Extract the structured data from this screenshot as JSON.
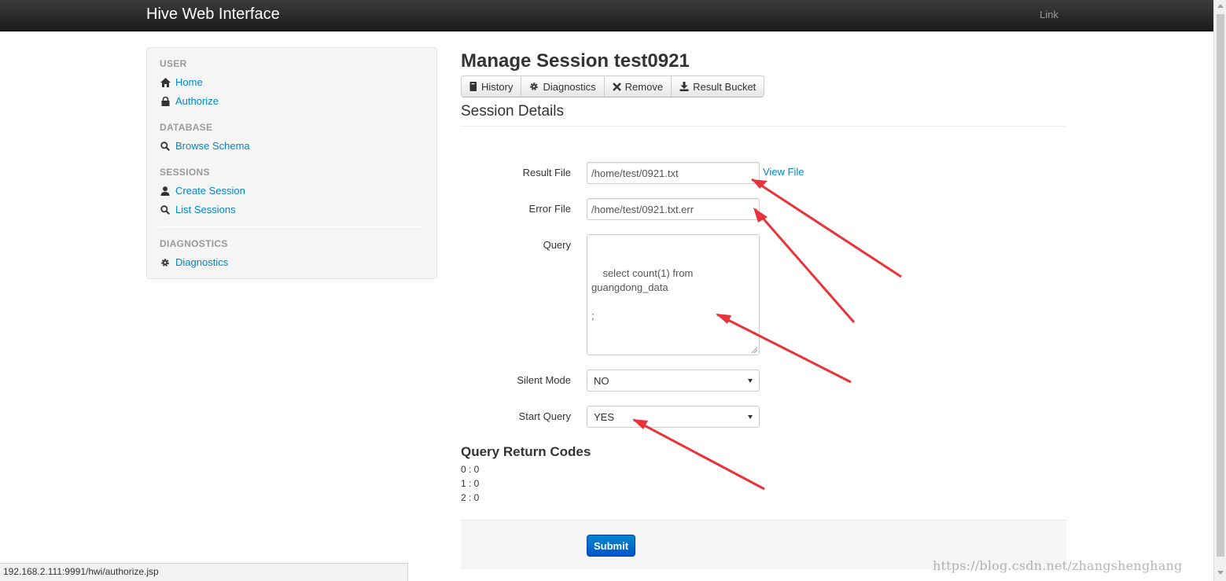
{
  "navbar": {
    "brand": "Hive Web Interface",
    "link": "Link"
  },
  "sidebar": {
    "sections": [
      {
        "header": "USER",
        "items": [
          {
            "label": "Home",
            "icon": "home-icon"
          },
          {
            "label": "Authorize",
            "icon": "lock-icon"
          }
        ]
      },
      {
        "header": "DATABASE",
        "items": [
          {
            "label": "Browse Schema",
            "icon": "search-icon"
          }
        ]
      },
      {
        "header": "SESSIONS",
        "items": [
          {
            "label": "Create Session",
            "icon": "user-icon"
          },
          {
            "label": "List Sessions",
            "icon": "search-icon"
          }
        ]
      },
      {
        "header": "DIAGNOSTICS",
        "items": [
          {
            "label": "Diagnostics",
            "icon": "gear-icon"
          }
        ]
      }
    ]
  },
  "main": {
    "title": "Manage Session test0921",
    "buttons": [
      {
        "label": "History",
        "icon": "book-icon"
      },
      {
        "label": "Diagnostics",
        "icon": "gear-icon"
      },
      {
        "label": "Remove",
        "icon": "remove-icon"
      },
      {
        "label": "Result Bucket",
        "icon": "download-icon"
      }
    ],
    "section_title": "Session Details",
    "form": {
      "result_file_label": "Result File",
      "result_file_value": "/home/test/0921.txt",
      "view_file_link": "View File",
      "error_file_label": "Error File",
      "error_file_value": "/home/test/0921.txt.err",
      "query_label": "Query",
      "query_value": "select count(1) from\nguangdong_data\n\n;",
      "silent_mode_label": "Silent Mode",
      "silent_mode_value": "NO",
      "start_query_label": "Start Query",
      "start_query_value": "YES"
    },
    "codes_title": "Query Return Codes",
    "codes": [
      "0 : 0",
      "1 : 0",
      "2 : 0"
    ],
    "submit_label": "Submit"
  },
  "status_bar": {
    "url": "192.168.2.111:9991/hwi/authorize.jsp"
  },
  "watermark": "https://blog.csdn.net/zhangshenghang",
  "colors": {
    "link": "#0088cc",
    "annotation_arrow": "#e8333a",
    "navbar": "#222222",
    "primary_button": "#0066cc"
  }
}
